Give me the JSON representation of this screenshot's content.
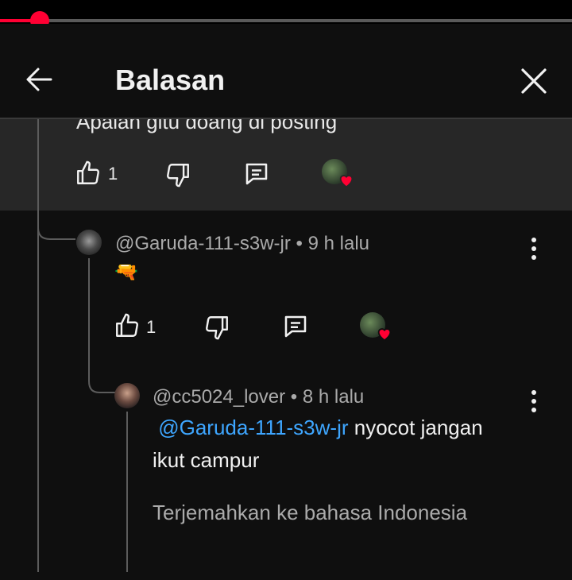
{
  "player": {
    "progress_percent": 7
  },
  "header": {
    "title": "Balasan"
  },
  "parent": {
    "text": "Apaian gitu doang di posting",
    "like_count": "1"
  },
  "reply1": {
    "author": "@Garuda-111-s3w-jr",
    "time": "9 h lalu",
    "emoji": "🔫",
    "like_count": "1"
  },
  "reply2": {
    "author": "@cc5024_lover",
    "time": "8 h lalu",
    "mention": "@Garuda-111-s3w-jr",
    "text_line1_rest": "nyocot jangan",
    "text_line2": "ikut campur",
    "translate": "Terjemahkan ke bahasa Indonesia"
  },
  "colors": {
    "accent": "#ff0033",
    "mention": "#3ea6ff",
    "heart": "#ff0033"
  },
  "icons": [
    "back-arrow-icon",
    "close-icon",
    "thumb-up-icon",
    "thumb-down-icon",
    "reply-icon",
    "more-vert-icon",
    "heart-icon"
  ]
}
